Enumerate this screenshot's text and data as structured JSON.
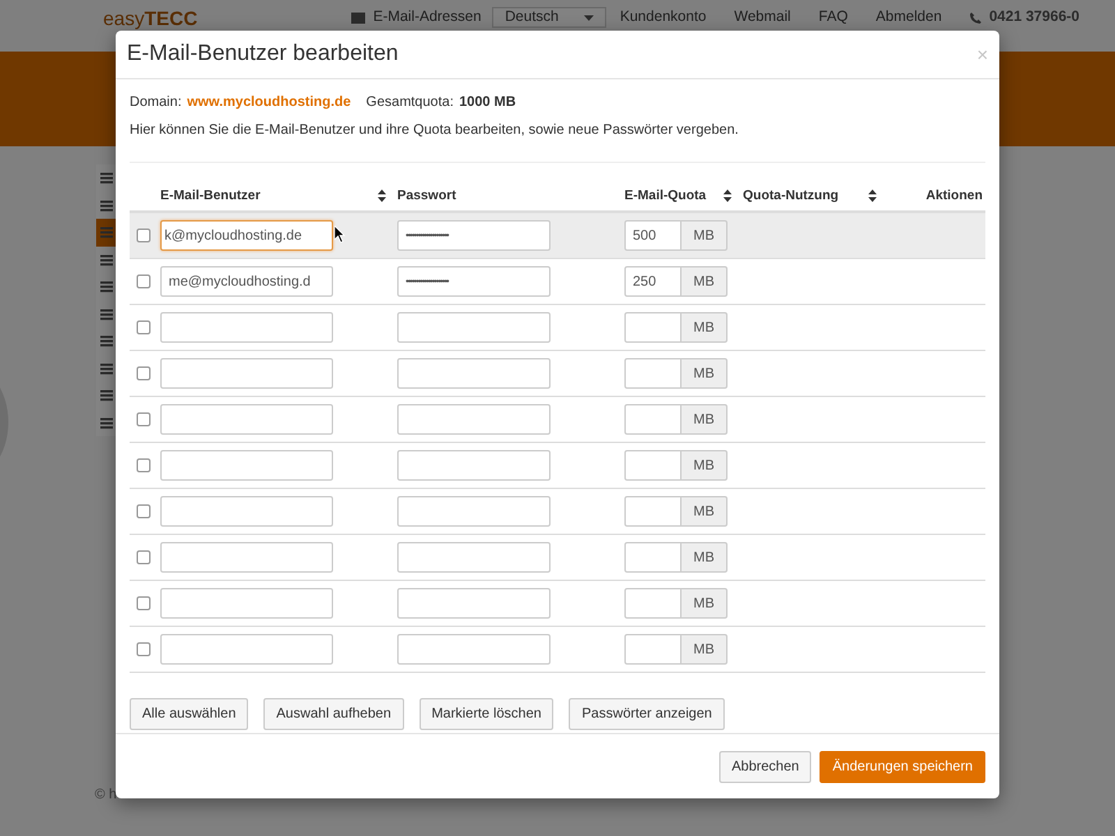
{
  "background": {
    "logo": {
      "light": "easy",
      "bold": "TECC"
    },
    "nav": [
      {
        "kind": "icon-link",
        "label": "E-Mail-Adressen"
      },
      {
        "kind": "select",
        "label": "Deutsch"
      },
      {
        "kind": "link",
        "label": "Kundenkonto"
      },
      {
        "kind": "link",
        "label": "Webmail"
      },
      {
        "kind": "link",
        "label": "FAQ"
      },
      {
        "kind": "link",
        "label": "Abmelden"
      },
      {
        "kind": "phone",
        "label": "0421 37966-0"
      }
    ],
    "sidebar": [
      {
        "selected": false
      },
      {
        "selected": false
      },
      {
        "selected": true
      },
      {
        "selected": false
      },
      {
        "selected": false
      },
      {
        "selected": false
      },
      {
        "selected": false
      },
      {
        "selected": false
      },
      {
        "selected": false
      },
      {
        "selected": false
      }
    ],
    "footer": "© h"
  },
  "dialog": {
    "title": "E-Mail-Benutzer bearbeiten",
    "close": "×",
    "domain_label": "Domain:",
    "domain": "www.mycloudhosting.de",
    "quota_label": "Gesamtquota:",
    "quota": "1000 MB",
    "intro": "Hier können Sie die E-Mail-Benutzer und ihre Quota bearbeiten, sowie neue Passwörter vergeben.",
    "columns": [
      {
        "label": "E-Mail-Benutzer",
        "sortable": true
      },
      {
        "label": "Passwort",
        "sortable": false
      },
      {
        "label": "E-Mail-Quota",
        "sortable": true
      },
      {
        "label": "Quota-Nutzung",
        "sortable": true
      },
      {
        "label": "Aktionen",
        "sortable": false
      }
    ],
    "rows": [
      {
        "checked": false,
        "highlighted": true,
        "focused": true,
        "email": "k@mycloudhosting.de",
        "password": "•••••••••••••••••••••",
        "quota": "500",
        "unit": "MB"
      },
      {
        "checked": false,
        "highlighted": false,
        "focused": false,
        "email": "me@mycloudhosting.d",
        "password": "•••••••••••••••••••••",
        "quota": "250",
        "unit": "MB"
      },
      {
        "checked": false,
        "highlighted": false,
        "focused": false,
        "unit": "MB"
      },
      {
        "checked": false,
        "highlighted": false,
        "focused": false,
        "unit": "MB"
      },
      {
        "checked": false,
        "highlighted": false,
        "focused": false,
        "unit": "MB"
      },
      {
        "checked": false,
        "highlighted": false,
        "focused": false,
        "unit": "MB"
      },
      {
        "checked": false,
        "highlighted": false,
        "focused": false,
        "unit": "MB"
      },
      {
        "checked": false,
        "highlighted": false,
        "focused": false,
        "unit": "MB"
      },
      {
        "checked": false,
        "highlighted": false,
        "focused": false,
        "unit": "MB"
      },
      {
        "checked": false,
        "highlighted": false,
        "focused": false,
        "unit": "MB"
      }
    ],
    "table_buttons": [
      "Alle auswählen",
      "Auswahl aufheben",
      "Markierte löschen",
      "Passwörter anzeigen"
    ],
    "footer_buttons": [
      {
        "label": "Abbrechen",
        "kind": "default"
      },
      {
        "label": "Änderungen speichern",
        "kind": "primary"
      }
    ]
  }
}
